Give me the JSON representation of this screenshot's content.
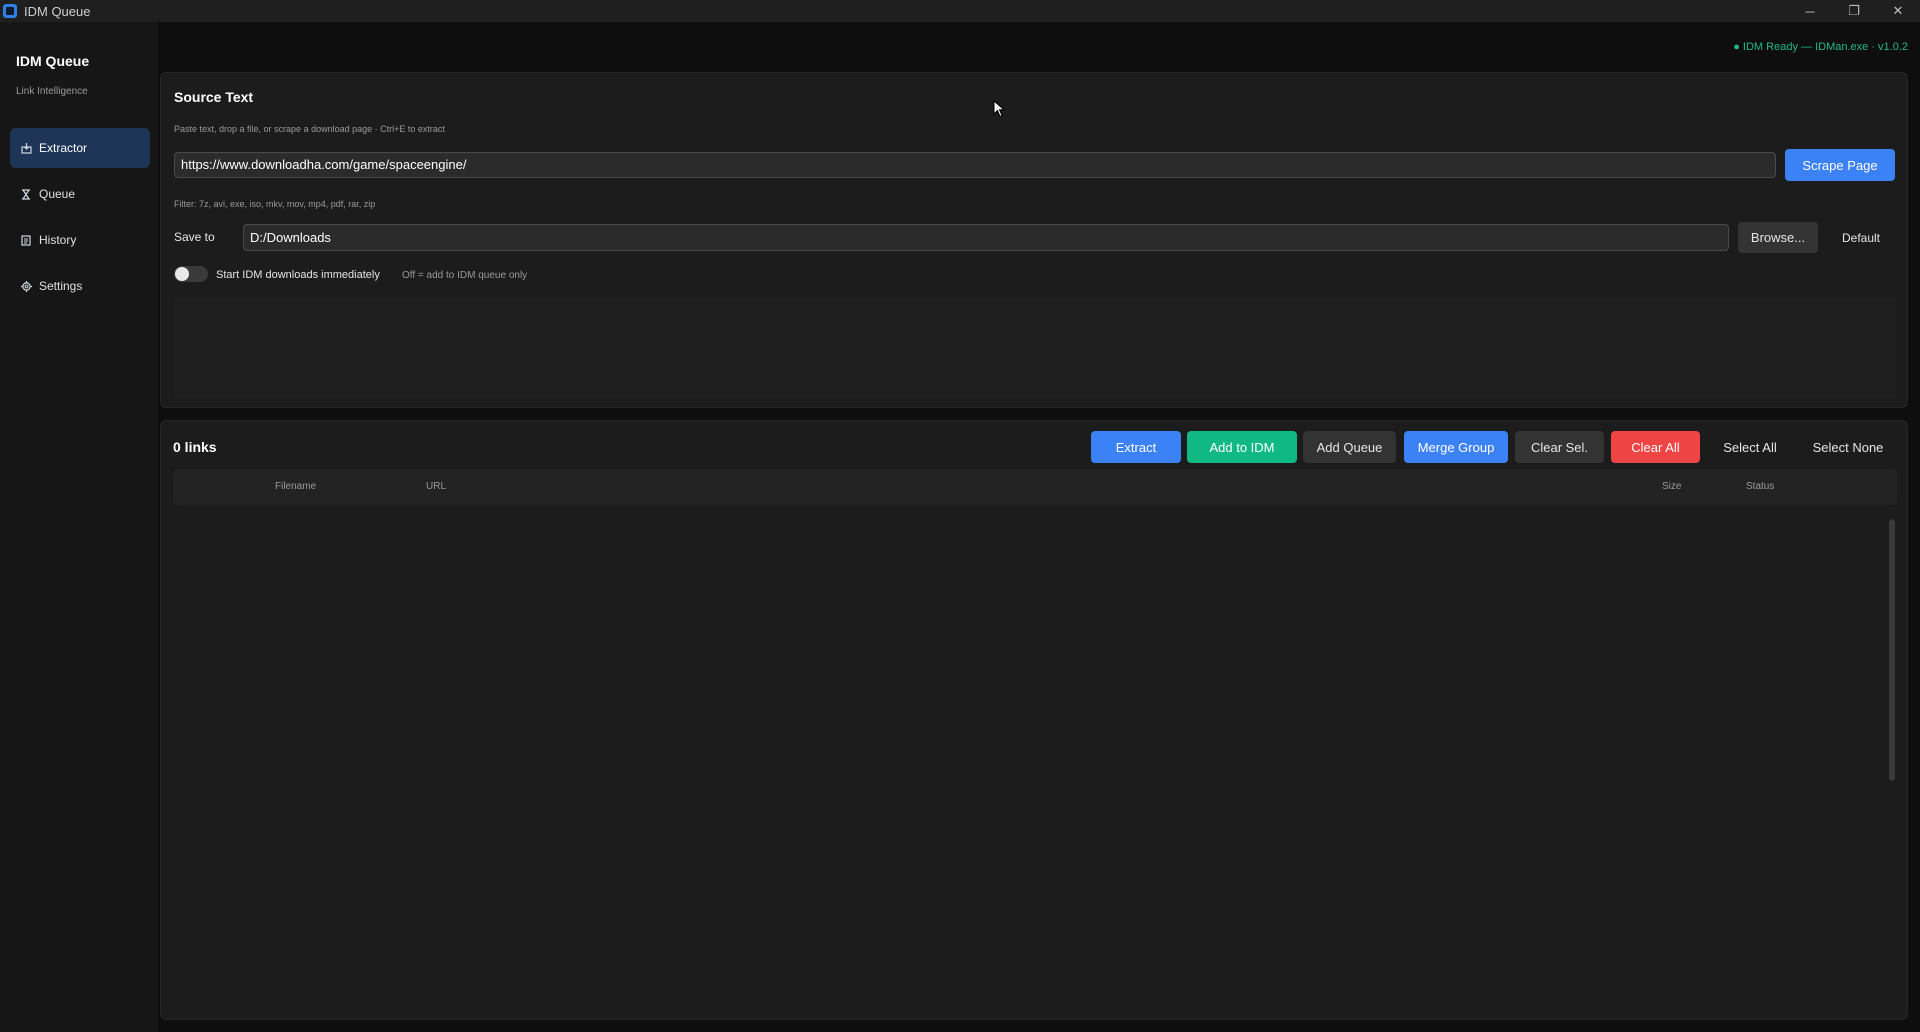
{
  "window": {
    "title": "IDM Queue",
    "controls": [
      "─",
      "❐",
      "✕"
    ]
  },
  "sidebar": {
    "brand": "IDM Queue",
    "subtitle": "Link Intelligence",
    "items": [
      {
        "label": "Extractor",
        "icon": "extract-icon",
        "active": true
      },
      {
        "label": "Queue",
        "icon": "hourglass-icon",
        "active": false
      },
      {
        "label": "History",
        "icon": "history-icon",
        "active": false
      },
      {
        "label": "Settings",
        "icon": "gear-icon",
        "active": false
      }
    ]
  },
  "status": {
    "text": "● IDM Ready — IDMan.exe  ·  v1.0.2",
    "color": "#23b985"
  },
  "source": {
    "title": "Source Text",
    "hint": "Paste text, drop a file, or scrape a download page · Ctrl+E to extract",
    "url_value": "https://www.downloadha.com/game/spaceengine/",
    "scrape_label": "Scrape Page",
    "filter": "Filter: 7z, avi, exe, iso, mkv, mov, mp4, pdf, rar, zip",
    "save_label": "Save to",
    "save_value": "D:/Downloads",
    "browse_label": "Browse...",
    "default_label": "Default",
    "toggle_label": "Start IDM downloads immediately",
    "toggle_sub": "Off = add to IDM queue only",
    "toggle_on": false
  },
  "links": {
    "count_label": "0 links",
    "buttons": {
      "extract": "Extract",
      "add_idm": "Add to IDM",
      "add_queue": "Add Queue",
      "merge_group": "Merge Group",
      "clear_sel": "Clear Sel.",
      "clear_all": "Clear All",
      "select_all": "Select All",
      "select_none": "Select None"
    },
    "columns": {
      "filename": "Filename",
      "url": "URL",
      "size": "Size",
      "status": "Status"
    },
    "rows": []
  },
  "colors": {
    "accent_blue": "#3b82f6",
    "accent_green": "#10b981",
    "accent_red": "#ef4444"
  }
}
